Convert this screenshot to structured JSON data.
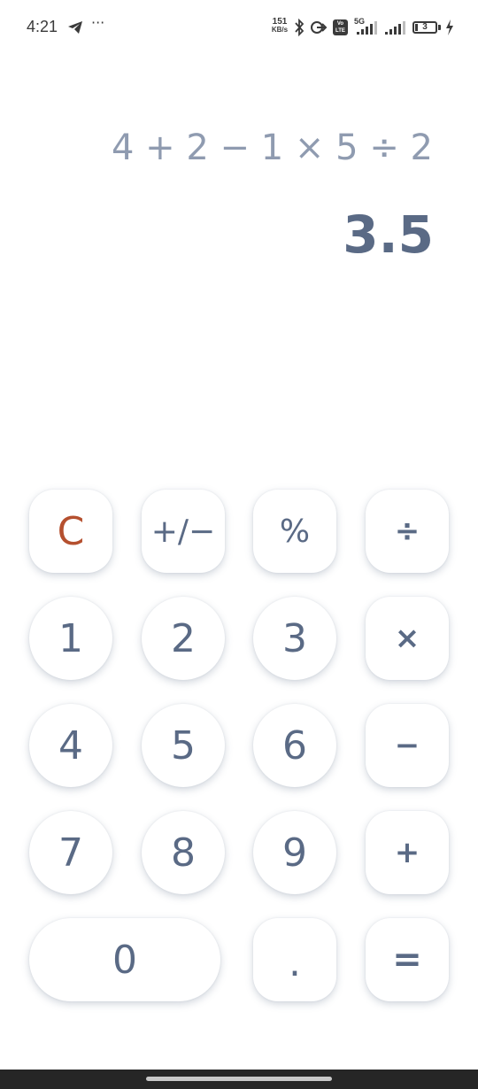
{
  "status_bar": {
    "time": "4:21",
    "more": "···",
    "net_speed_value": "151",
    "net_speed_unit": "KB/s",
    "volte_label": "Vo LTE",
    "network_label": "5G",
    "battery_level": "3",
    "icons": [
      "telegram-icon",
      "bluetooth-icon",
      "link-icon",
      "volte-icon",
      "signal-icon",
      "signal-icon",
      "battery-icon",
      "charging-icon"
    ]
  },
  "display": {
    "expression": "4 + 2 − 1 × 5 ÷ 2",
    "result": "3.5"
  },
  "keypad": {
    "clear": "C",
    "sign": "+/−",
    "percent": "%",
    "divide": "÷",
    "one": "1",
    "two": "2",
    "three": "3",
    "multiply": "×",
    "four": "4",
    "five": "5",
    "six": "6",
    "minus": "−",
    "seven": "7",
    "eight": "8",
    "nine": "9",
    "plus": "+",
    "zero": "0",
    "decimal": ".",
    "equals": "="
  },
  "colors": {
    "accent_clear": "#b5502f",
    "key_text": "#5a6a85",
    "expression_text": "#8f9bb0",
    "background": "#ffffff"
  }
}
